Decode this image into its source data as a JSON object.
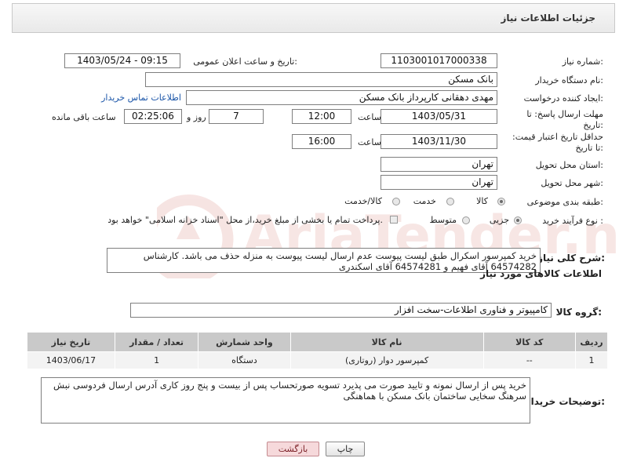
{
  "header": {
    "title": "جزئیات اطلاعات نیاز"
  },
  "fields": {
    "need_number_label": "شماره نیاز:",
    "need_number_value": "1103001017000338",
    "announce_label": "تاریخ و ساعت اعلان عمومی:",
    "announce_value": "1403/05/24 - 09:15",
    "buyer_org_label": "نام دستگاه خریدار:",
    "buyer_org_value": "بانک مسکن",
    "requester_label": "ایجاد کننده درخواست:",
    "requester_value": "مهدی دهقانی کارپرداز بانک مسکن",
    "buyer_contact_link": "اطلاعات تماس خریدار",
    "reply_deadline_label": "مهلت ارسال پاسخ: تا تاریخ:",
    "reply_date": "1403/05/31",
    "time_label": "ساعت",
    "reply_time": "12:00",
    "days_value": "7",
    "days_label": "روز و",
    "remaining_value": "02:25:06",
    "remaining_label": "ساعت باقی مانده",
    "price_validity_label": "حداقل تاریخ اعتبار قیمت: تا تاریخ:",
    "price_date": "1403/11/30",
    "price_time_label": "ساعت",
    "price_time": "16:00",
    "province_label": "استان محل تحویل:",
    "province_value": "تهران",
    "city_label": "شهر محل تحویل:",
    "city_value": "تهران",
    "category_label": "طبقه بندی موضوعی:",
    "category_options": [
      "کالا",
      "خدمت",
      "کالا/خدمت"
    ],
    "process_label": "نوع فرآیند خرید :",
    "process_options": [
      "جزیی",
      "متوسط"
    ],
    "payment_text": "پرداخت تمام یا بخشی از مبلغ خرید،از محل \"اسناد خزانه اسلامی\" خواهد بود."
  },
  "description": {
    "label": "شرح کلی نیاز:",
    "text": "خرید کمپرسور اسکرال طبق لیست پیوست عدم ارسال لیست پیوست به منزله حذف می باشد. کارشناس 64574282 آقای فهیم و 64574281 آقای اسکندری"
  },
  "goods_info": {
    "title": "اطلاعات کالاهای مورد نیاز",
    "group_label": "گروه کالا:",
    "group_value": "کامپیوتر و فناوری اطلاعات-سخت افزار"
  },
  "table": {
    "headers": [
      "ردیف",
      "کد کالا",
      "نام کالا",
      "واحد شمارش",
      "تعداد / مقدار",
      "تاریخ نیاز"
    ],
    "rows": [
      [
        "1",
        "--",
        "کمپرسور دوار (روتاری)",
        "دستگاه",
        "1",
        "1403/06/17"
      ]
    ]
  },
  "buyer_notes": {
    "label": "توضیحات خریدار:",
    "text": "خرید پس از ارسال نمونه و تایید صورت می پذیرد تسویه صورتحساب پس از  بیست و پنج روز کاری آدرس ارسال فردوسی نبش سرهنگ سخایی ساختمان بانک مسکن با هماهنگی"
  },
  "buttons": {
    "print": "چاپ",
    "back": "بازگشت"
  },
  "watermark": {
    "text": "AriaTender.net"
  }
}
